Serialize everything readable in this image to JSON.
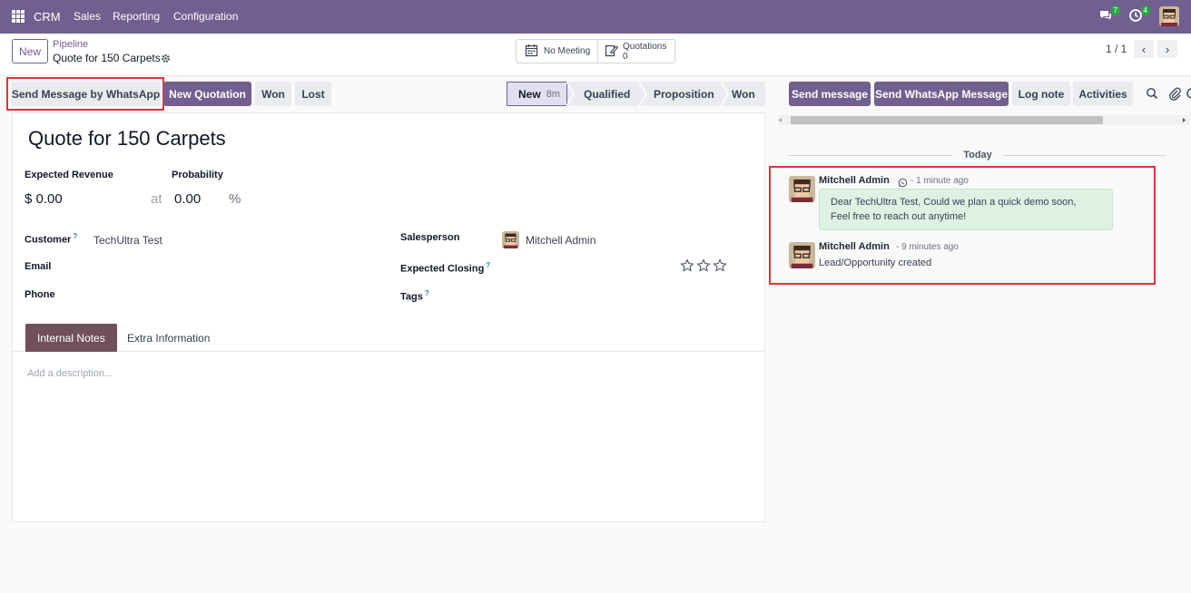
{
  "topbar": {
    "brand": "CRM",
    "menu": [
      "Sales",
      "Reporting",
      "Configuration"
    ],
    "messages_count": "7",
    "activities_count": "4",
    "bg_color": "#715f8f"
  },
  "control": {
    "new_label": "New",
    "breadcrumb_parent": "Pipeline",
    "breadcrumb_current": "Quote for 150 Carpets",
    "smart_meeting": "No Meeting",
    "smart_quotations_label": "Quotations",
    "smart_quotations_count": "0",
    "pager": "1 / 1"
  },
  "actions": {
    "whatsapp": "Send Message by WhatsApp",
    "new_quotation": "New Quotation",
    "won": "Won",
    "lost": "Lost"
  },
  "stages": [
    {
      "label": "New",
      "sub": "8m",
      "active": true
    },
    {
      "label": "Qualified",
      "sub": "",
      "active": false
    },
    {
      "label": "Proposition",
      "sub": "",
      "active": false
    },
    {
      "label": "Won",
      "sub": "",
      "active": false
    }
  ],
  "form": {
    "title": "Quote for 150 Carpets",
    "expected_revenue_label": "Expected Revenue",
    "expected_revenue": "$ 0.00",
    "at": "at",
    "probability_label": "Probability",
    "probability": "0.00",
    "percent": "%",
    "customer_label": "Customer",
    "customer": "TechUltra Test",
    "email_label": "Email",
    "phone_label": "Phone",
    "salesperson_label": "Salesperson",
    "salesperson": "Mitchell Admin",
    "expected_closing_label": "Expected Closing",
    "tags_label": "Tags",
    "help_mark": "?",
    "priority_stars": 0
  },
  "tabs": {
    "internal_notes": "Internal Notes",
    "extra_information": "Extra Information",
    "description_placeholder": "Add a description..."
  },
  "chatter": {
    "send_message": "Send message",
    "send_whatsapp": "Send WhatsApp Message",
    "log_note": "Log note",
    "activities": "Activities",
    "today": "Today",
    "messages": [
      {
        "author": "Mitchell Admin",
        "time": "- 1 minute ago",
        "line1": "Dear TechUltra Test, Could we plan a quick demo soon,",
        "line2": "Feel free to reach out anytime!"
      },
      {
        "author": "Mitchell Admin",
        "time": "- 9 minutes ago",
        "body": "Lead/Opportunity created"
      }
    ]
  },
  "colors": {
    "primary": "#715f8f",
    "highlight": "#d9363e",
    "whatsapp_bubble": "#dff1e3"
  }
}
